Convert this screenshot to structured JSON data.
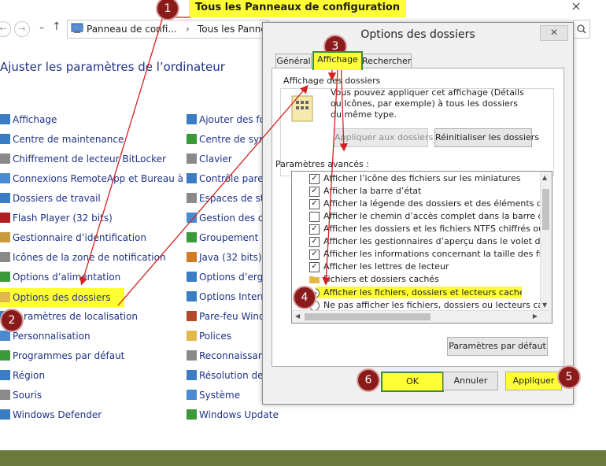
{
  "annotation_title": "Tous les Panneaux de configuration",
  "badges": [
    "1",
    "2",
    "3",
    "4",
    "5",
    "6"
  ],
  "navbar": {
    "address_crumb_1": "Panneau de confi...",
    "address_sep": "›",
    "address_crumb_2": "Tous les Panneau"
  },
  "page_heading": "Ajuster les paramètres de l’ordinateur",
  "left_items": [
    "Affichage",
    "Centre de maintenance",
    "Chiffrement de lecteur BitLocker",
    "Connexions RemoteApp et Bureau à ...",
    "Dossiers de travail",
    "Flash Player (32 bits)",
    "Gestionnaire d’identification",
    "Icônes de la zone de notification",
    "Options d’alimentation",
    "Options des dossiers",
    "Paramètres de localisation",
    "Personnalisation",
    "Programmes par défaut",
    "Région",
    "Souris",
    "Windows Defender"
  ],
  "right_items": [
    "Ajouter des for",
    "Centre de sync",
    "Clavier",
    "Contrôle paren",
    "Espaces de sto",
    "Gestion des co",
    "Groupement ré",
    "Java (32 bits)",
    "Options d’ergo",
    "Options Interne",
    "Pare-feu Windo",
    "Polices",
    "Reconnaissanc",
    "Résolution des",
    "Système",
    "Windows Update"
  ],
  "dialog": {
    "title": "Options des dossiers",
    "close": "✕",
    "tabs": [
      "Général",
      "Affichage",
      "Rechercher"
    ],
    "folder_view_label": "Affichage des dossiers",
    "folder_view_desc": "Vous pouvez appliquer cet affichage (Détails ou Icônes, par exemple) à tous les dossiers du même type.",
    "apply_folders": "Appliquer aux dossiers",
    "reset_folders": "Réinitialiser les dossiers",
    "advanced_label": "Paramètres avancés :",
    "tree": [
      {
        "kind": "check",
        "checked": true,
        "label": "Afficher l’icône des fichiers sur les miniatures"
      },
      {
        "kind": "check",
        "checked": true,
        "label": "Afficher la barre d’état"
      },
      {
        "kind": "check",
        "checked": true,
        "label": "Afficher la légende des dossiers et des éléments du Burea"
      },
      {
        "kind": "check",
        "checked": false,
        "label": "Afficher le chemin d’accès complet dans la barre de titre"
      },
      {
        "kind": "check",
        "checked": true,
        "label": "Afficher les dossiers et les fichiers NTFS chiffrés ou comp"
      },
      {
        "kind": "check",
        "checked": true,
        "label": "Afficher les gestionnaires d’aperçu dans le volet de visual"
      },
      {
        "kind": "check",
        "checked": true,
        "label": "Afficher les informations concernant la taille des fichiers da"
      },
      {
        "kind": "check",
        "checked": true,
        "label": "Afficher les lettres de lecteur"
      },
      {
        "kind": "folder",
        "label": "Fichiers et dossiers cachés"
      },
      {
        "kind": "radio",
        "checked": true,
        "label": "Afficher les fichiers, dossiers et lecteurs cachés"
      },
      {
        "kind": "radio",
        "checked": false,
        "label": "Ne pas afficher les fichiers, dossiers ou lecteurs cach"
      }
    ],
    "defaults": "Paramètres par défaut",
    "ok": "OK",
    "cancel": "Annuler",
    "apply": "Appliquer"
  },
  "colors": {
    "highlight": "#ffff33",
    "badge": "#8b1a1a",
    "arrow": "#d42020",
    "link": "#1e3287"
  }
}
